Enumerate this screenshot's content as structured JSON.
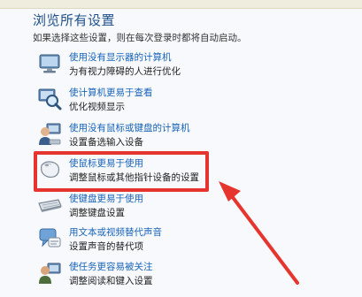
{
  "page": {
    "title": "浏览所有设置",
    "subtitle": "如果选择这些设置，则在每次登录时都将自动启动。"
  },
  "items": [
    {
      "icon": "monitor-icon",
      "link": "使用没有显示器的计算机",
      "desc": "为有视力障碍的人进行优化"
    },
    {
      "icon": "magnifier-icon",
      "link": "使计算机更易于查看",
      "desc": "优化视频显示"
    },
    {
      "icon": "user-keyboard-icon",
      "link": "使用没有鼠标或键盘的计算机",
      "desc": "设置备选输入设备"
    },
    {
      "icon": "mouse-icon",
      "link": "使鼠标更易于使用",
      "desc": "调整鼠标或其他指针设备的设置"
    },
    {
      "icon": "keyboard-icon",
      "link": "使键盘更易于使用",
      "desc": "调整键盘设置"
    },
    {
      "icon": "speech-bubble-icon",
      "link": "用文本或视频替代声音",
      "desc": "设置声音的替代项"
    },
    {
      "icon": "user-monitor-icon",
      "link": "使任务更容易被关注",
      "desc": "调整阅读和键入设置"
    }
  ],
  "annotation": {
    "box_color": "#e6342f",
    "arrow_color": "#e6342f"
  }
}
